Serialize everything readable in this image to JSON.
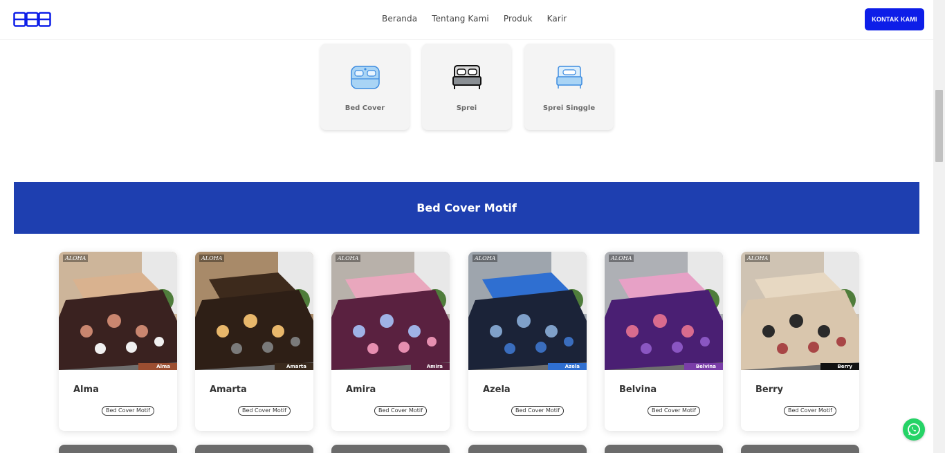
{
  "header": {
    "logo_icon": "logo-mark",
    "nav": [
      "Beranda",
      "Tentang Kami",
      "Produk",
      "Karir"
    ],
    "contact_label": "KONTAK KAMI",
    "accent": "#0d1ee8"
  },
  "categories": [
    {
      "label": "Bed Cover",
      "icon": "bed-cover-icon"
    },
    {
      "label": "Sprei",
      "icon": "bed-sheet-icon"
    },
    {
      "label": "Sprei Singgle",
      "icon": "single-bed-icon"
    }
  ],
  "banner": {
    "title": "Bed Cover Motif",
    "color": "#1e3fb0"
  },
  "products": [
    {
      "name": "Alma",
      "tag": "Alma",
      "category": "Bed Cover Motif",
      "brand": "ALOHA",
      "tag_color": "#9b4e31"
    },
    {
      "name": "Amarta",
      "tag": "Amarta",
      "category": "Bed Cover Motif",
      "brand": "ALOHA",
      "tag_color": "#3a2a1d"
    },
    {
      "name": "Amira",
      "tag": "Amira",
      "category": "Bed Cover Motif",
      "brand": "ALOHA",
      "tag_color": "#5a2140"
    },
    {
      "name": "Azela",
      "tag": "Azela",
      "category": "Bed Cover Motif",
      "brand": "ALOHA",
      "tag_color": "#2f6fd1"
    },
    {
      "name": "Belvina",
      "tag": "Belvina",
      "category": "Bed Cover Motif",
      "brand": "ALOHA",
      "tag_color": "#7a3da8"
    },
    {
      "name": "Berry",
      "tag": "Berry",
      "category": "Bed Cover Motif",
      "brand": "ALOHA",
      "tag_color": "#111111"
    }
  ],
  "whatsapp_icon": "whatsapp-icon"
}
